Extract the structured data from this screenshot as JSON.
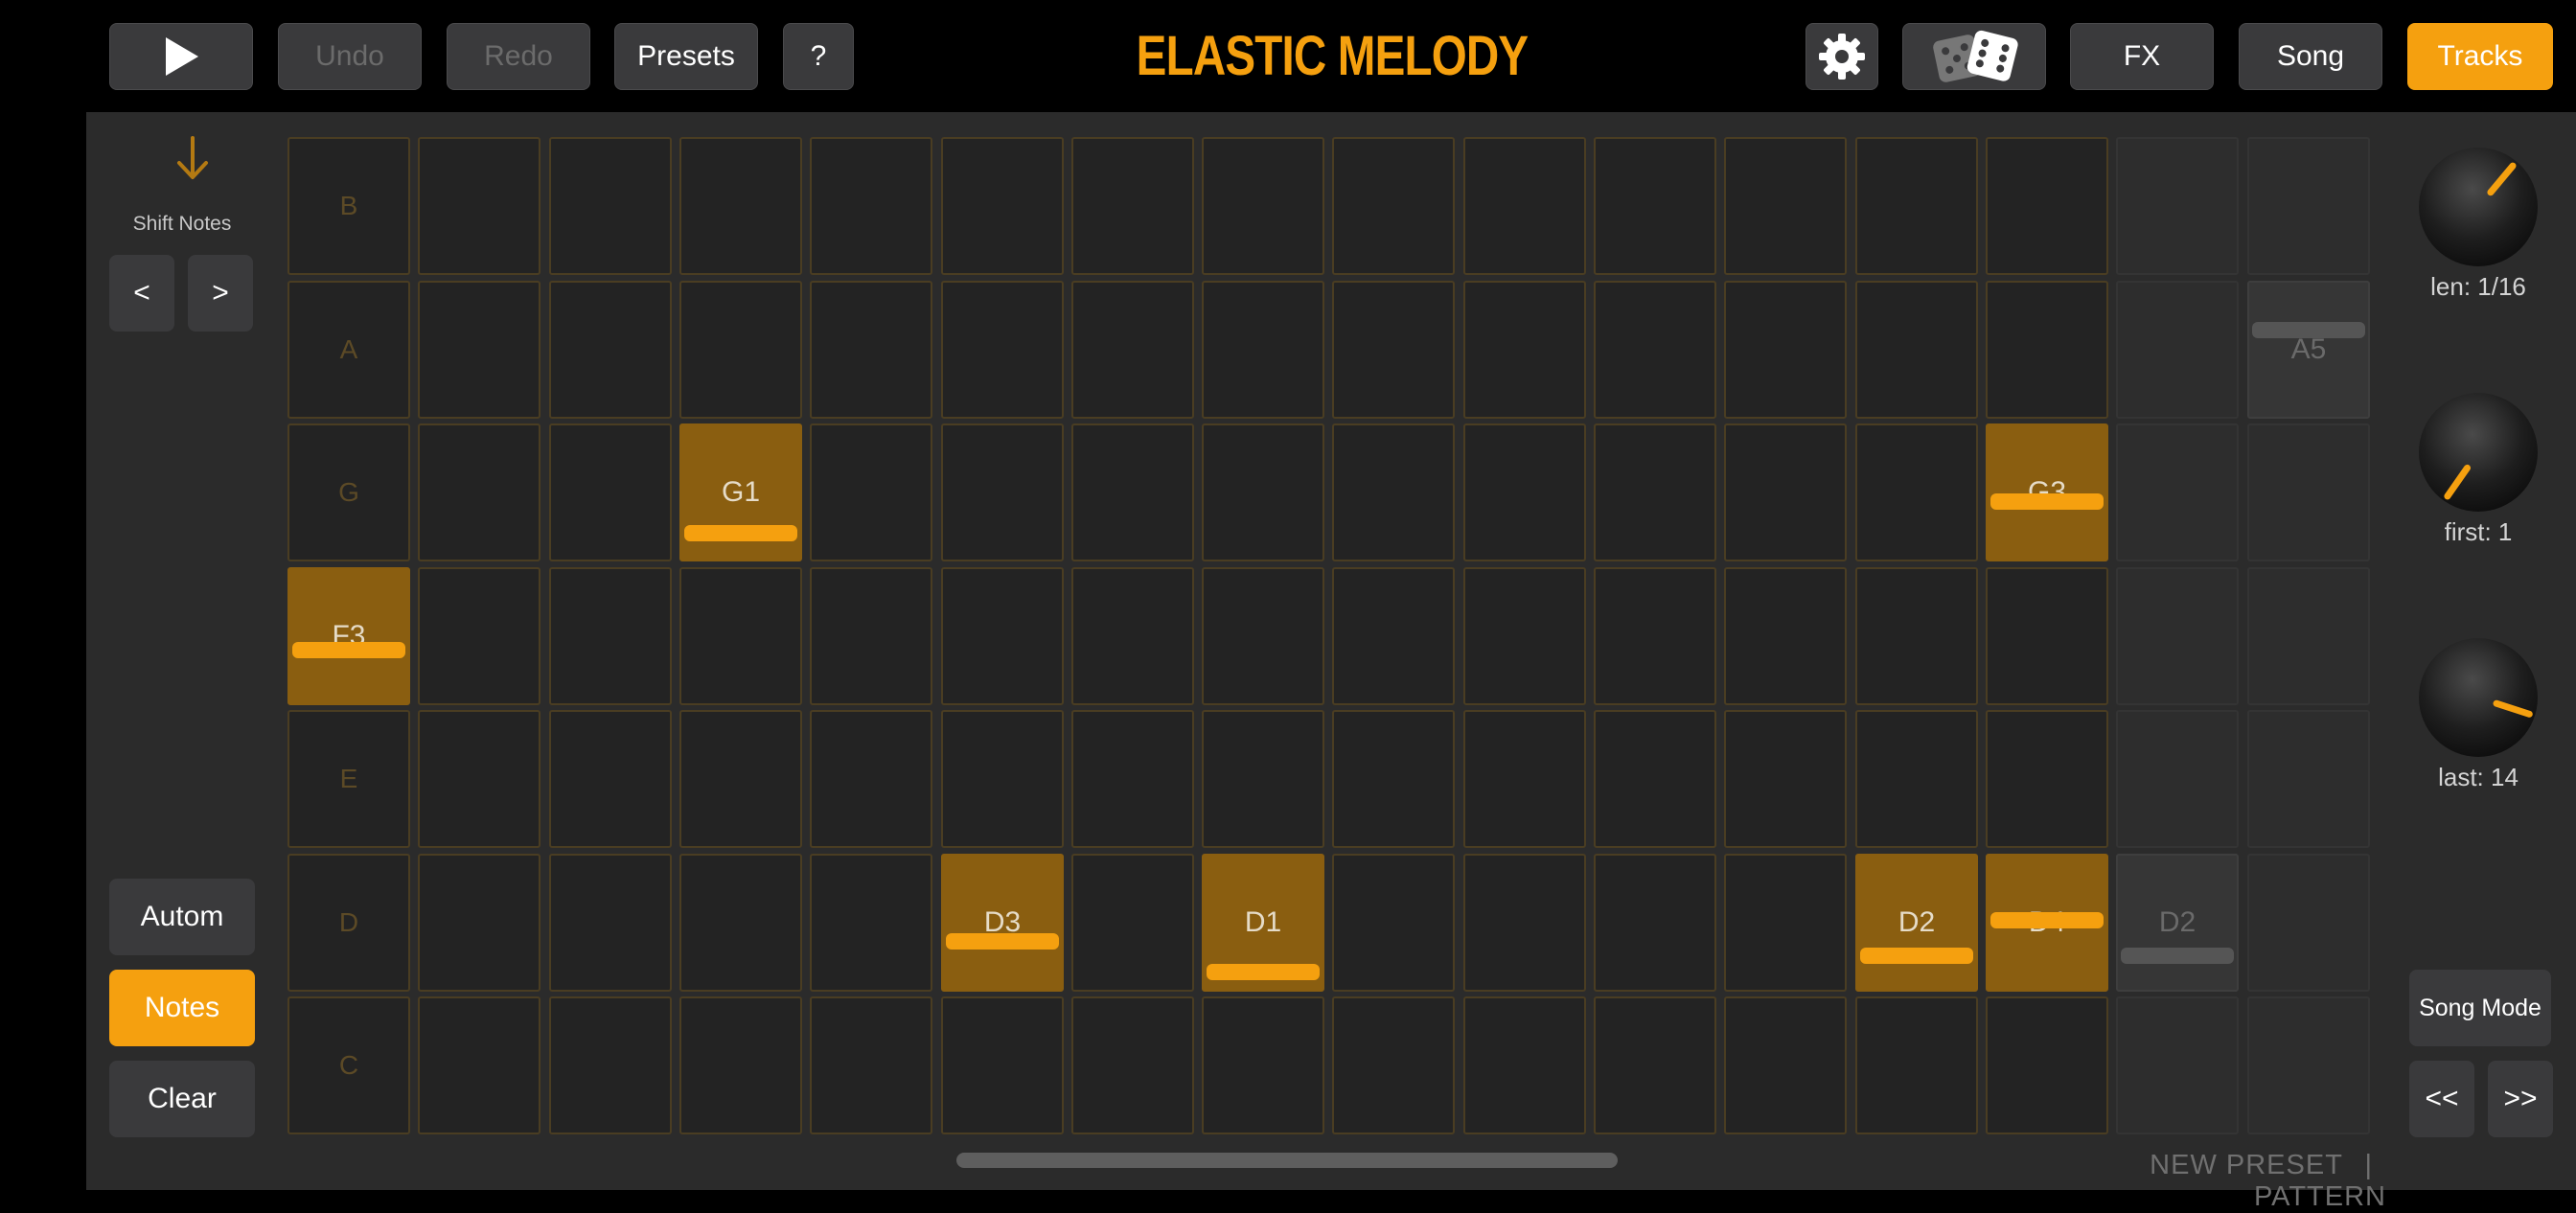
{
  "toolbar": {
    "undo_label": "Undo",
    "redo_label": "Redo",
    "presets_label": "Presets",
    "help_label": "?",
    "title": "ELASTIC MELODY",
    "fx_label": "FX",
    "song_label": "Song",
    "tracks_label": "Tracks"
  },
  "left_panel": {
    "shift_label": "Shift Notes",
    "shift_left": "<",
    "shift_right": ">",
    "autom_label": "Autom",
    "notes_label": "Notes",
    "clear_label": "Clear"
  },
  "grid": {
    "row_letters": [
      "B",
      "A",
      "G",
      "F",
      "E",
      "D",
      "C"
    ],
    "columns": 16,
    "active_columns": [
      1,
      14
    ],
    "notes": [
      {
        "row": "G",
        "col": 4,
        "label": "G1",
        "velocity": 0.15
      },
      {
        "row": "G",
        "col": 14,
        "label": "G3",
        "velocity": 0.42
      },
      {
        "row": "F",
        "col": 1,
        "label": "F3",
        "velocity": 0.38
      },
      {
        "row": "D",
        "col": 6,
        "label": "D3",
        "velocity": 0.34
      },
      {
        "row": "D",
        "col": 8,
        "label": "D1",
        "velocity": 0.08
      },
      {
        "row": "D",
        "col": 13,
        "label": "D2",
        "velocity": 0.22
      },
      {
        "row": "D",
        "col": 14,
        "label": "D4",
        "velocity": 0.52
      }
    ],
    "ghost_notes": [
      {
        "row": "A",
        "col": 16,
        "label": "A5",
        "velocity": 0.66
      },
      {
        "row": "D",
        "col": 15,
        "label": "D2",
        "velocity": 0.22
      }
    ]
  },
  "knobs": [
    {
      "label": "len: 1/16",
      "angle": 40
    },
    {
      "label": "first: 1",
      "angle": -145
    },
    {
      "label": "last: 14",
      "angle": 108
    }
  ],
  "right_panel": {
    "song_mode_label": "Song Mode",
    "prev_label": "<<",
    "next_label": ">>"
  },
  "footer": {
    "preset_name": "NEW PRESET",
    "separator": "|",
    "mode": "PATTERN"
  },
  "colors": {
    "accent": "#f5a00f",
    "note_fill": "#8a5e10",
    "background": "#2b2b2b"
  }
}
